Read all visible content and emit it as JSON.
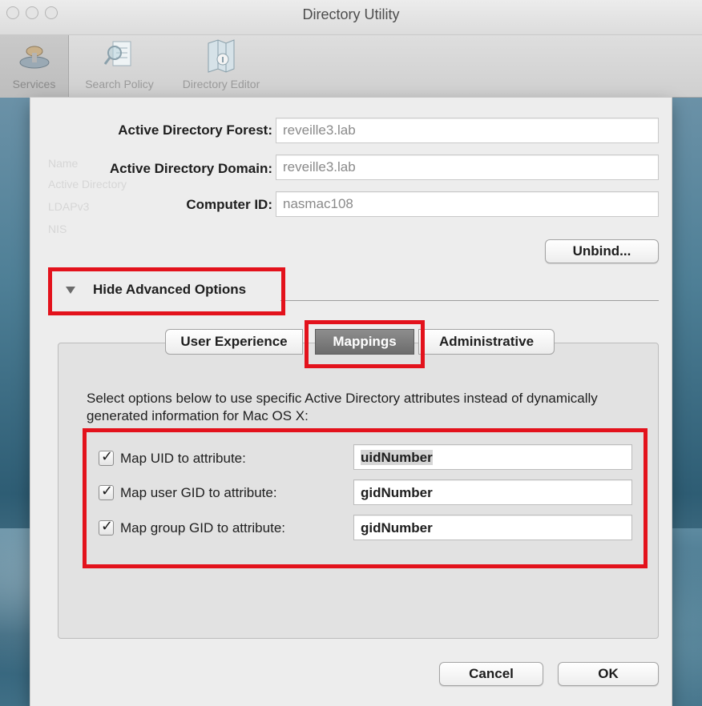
{
  "window": {
    "title": "Directory Utility",
    "toolbar": [
      {
        "label": "Services",
        "icon": "services-icon",
        "active": true
      },
      {
        "label": "Search Policy",
        "icon": "search-policy-icon"
      },
      {
        "label": "Directory Editor",
        "icon": "directory-editor-icon"
      }
    ]
  },
  "background_list": [
    "Name",
    "Active Directory",
    "LDAPv3",
    "NIS"
  ],
  "form": {
    "forest_label": "Active Directory Forest:",
    "forest_value": "reveille3.lab",
    "domain_label": "Active Directory Domain:",
    "domain_value": "reveille3.lab",
    "computer_label": "Computer ID:",
    "computer_value": "nasmac108",
    "unbind_button": "Unbind..."
  },
  "advanced": {
    "disclosure_label": "Hide Advanced Options",
    "tabs": [
      "User Experience",
      "Mappings",
      "Administrative"
    ],
    "selected_tab": "Mappings",
    "description": "Select options below to use specific Active Directory attributes instead of dynamically generated information for Mac OS X:",
    "mappings": [
      {
        "label": "Map UID to attribute:",
        "value": "uidNumber",
        "checked": true
      },
      {
        "label": "Map user GID to attribute:",
        "value": "gidNumber",
        "checked": true
      },
      {
        "label": "Map group GID to attribute:",
        "value": "gidNumber",
        "checked": true
      }
    ]
  },
  "buttons": {
    "cancel": "Cancel",
    "ok": "OK"
  },
  "colors": {
    "highlight": "#e3121c",
    "selected_tab": "#7a7a7a"
  }
}
